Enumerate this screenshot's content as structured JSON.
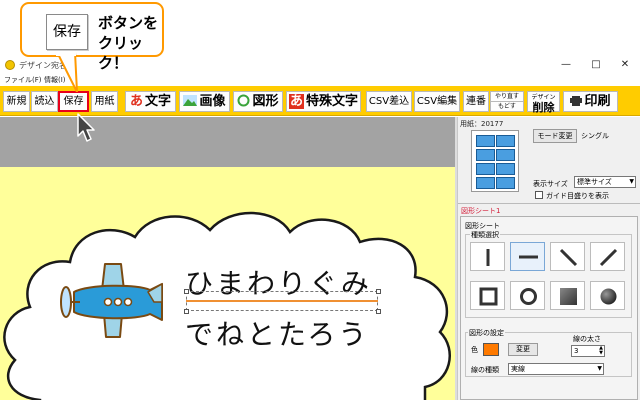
{
  "window": {
    "title": "デザイン宛名",
    "min_glyph": "—",
    "max_glyph": "□",
    "close_glyph": "✕"
  },
  "menu": {
    "file": "ファイル(F)",
    "info": "情報(I)"
  },
  "toolbar": {
    "new": "新規",
    "open": "読込",
    "save": "保存",
    "paper": "用紙",
    "text_glyph": "あ",
    "text": "文字",
    "image": "画像",
    "shape": "図形",
    "special_glyph": "あ",
    "special": "特殊文字",
    "csv_insert": "CSV差込",
    "csv_edit": "CSV編集",
    "serial": "連番",
    "undo": "やり直す",
    "redo": "もどす",
    "delete_top": "デザイン",
    "delete": "削除",
    "print": "印刷"
  },
  "canvas": {
    "line1": "ひまわりぐみ",
    "line2": "でねとたろう",
    "background_color": "#ffff9a",
    "selection_line_color": "#f09033"
  },
  "panel": {
    "paper_label": "用紙：20177",
    "mode_button": "モード変更",
    "mode_value": "シングル",
    "display_size_label": "表示サイズ",
    "display_size_value": "標準サイズ",
    "guide_label": "ガイド目盛りを表示",
    "sheet_tab": "図形シート1",
    "shape_sheet_title": "図形シート",
    "shape_type_title": "種類選択",
    "shape_settings_title": "図形の設定",
    "color_label": "色",
    "color_value": "#ff7a00",
    "change_button": "変更",
    "width_label": "線の太さ",
    "width_value": "3",
    "line_type_label": "線の種類",
    "line_type_value": "実線"
  },
  "callout": {
    "icon_label": "保存",
    "line1": "ボタンを",
    "line2": "クリック！",
    "border_color": "#ff9900"
  },
  "highlight_color": "#e8001a"
}
